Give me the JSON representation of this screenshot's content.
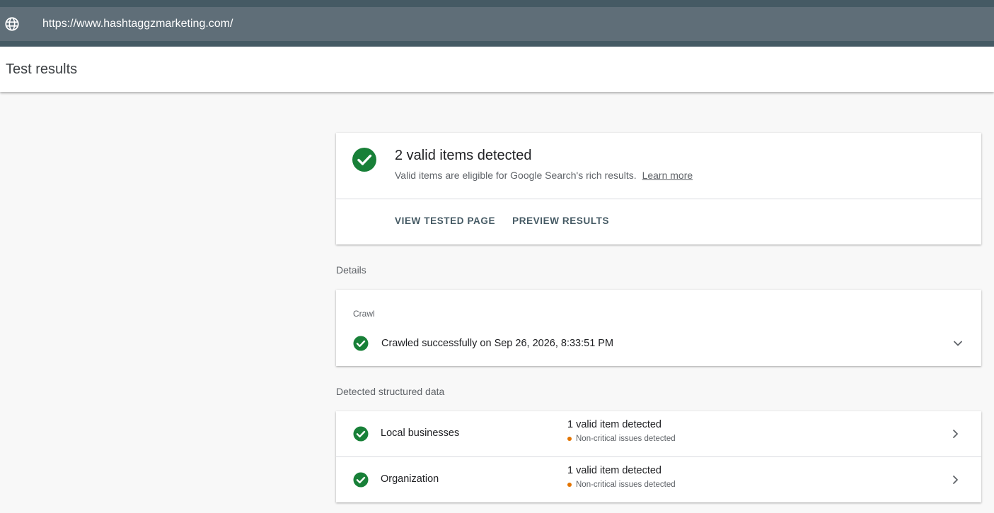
{
  "browser": {
    "url": "https://www.hashtaggzmarketing.com/"
  },
  "header": {
    "title": "Test results"
  },
  "summary": {
    "headline": "2 valid items detected",
    "description": "Valid items are eligible for Google Search's rich results.",
    "learn_more": "Learn more",
    "actions": {
      "view_tested_page": "VIEW TESTED PAGE",
      "preview_results": "PREVIEW RESULTS"
    }
  },
  "details": {
    "section_label": "Details",
    "crawl": {
      "label": "Crawl",
      "status": "Crawled successfully on Sep 26, 2026, 8:33:51 PM"
    }
  },
  "structured_data": {
    "section_label": "Detected structured data",
    "items": [
      {
        "name": "Local businesses",
        "status": "1 valid item detected",
        "issue": "Non-critical issues detected"
      },
      {
        "name": "Organization",
        "status": "1 valid item detected",
        "issue": "Non-critical issues detected"
      }
    ]
  },
  "icons": {
    "globe": "globe-icon",
    "check": "check-circle-icon",
    "expand": "chevron-down-icon",
    "open": "chevron-right-icon",
    "warning_dot": "warning-dot-icon"
  },
  "colors": {
    "success": "#188038",
    "warning": "#e37400",
    "url_bar": "#5f6e78",
    "top_strip": "#455a64",
    "action_text": "#455a64"
  }
}
